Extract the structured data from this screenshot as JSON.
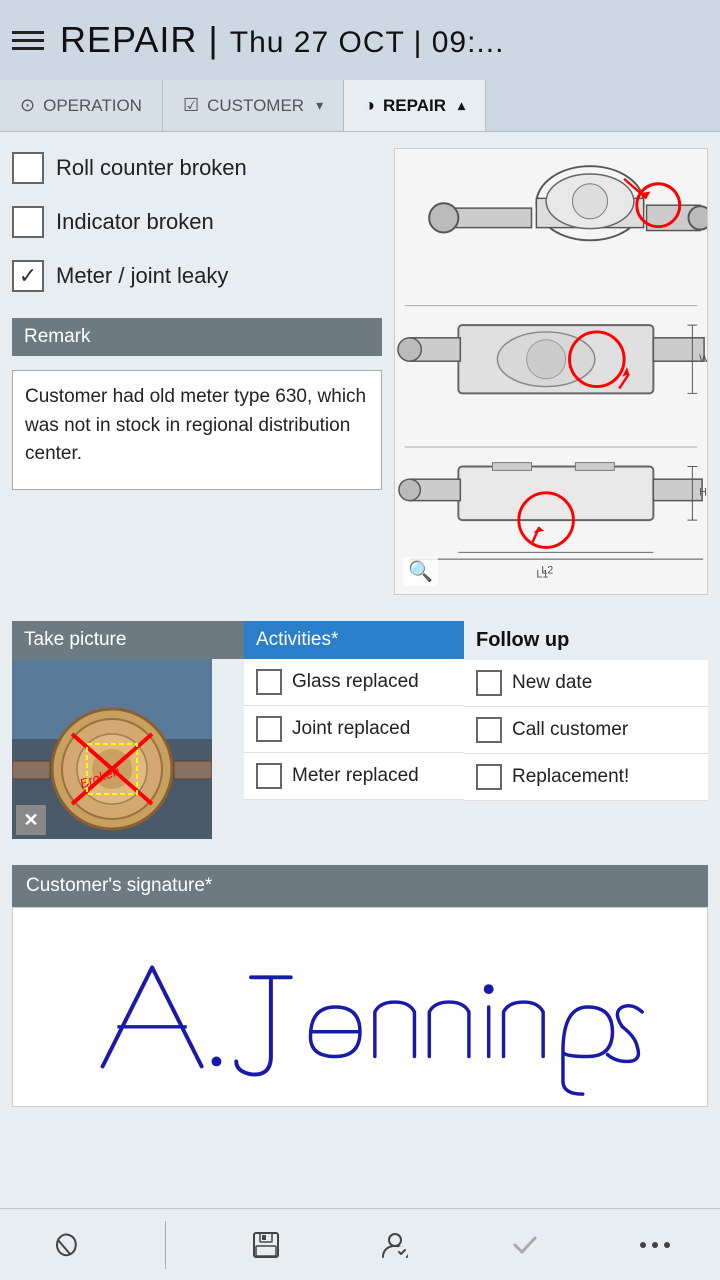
{
  "header": {
    "title": "REPAIR",
    "separator": "|",
    "datetime": "Thu 27 OCT | 09:..."
  },
  "tabs": [
    {
      "id": "operation",
      "label": "OPERATION",
      "icon": "⊙",
      "active": false,
      "hasChevron": false
    },
    {
      "id": "customer",
      "label": "CUSTOMER",
      "icon": "☑",
      "active": false,
      "hasChevron": true
    },
    {
      "id": "repair",
      "label": "REPAIR",
      "icon": "◑",
      "active": true,
      "hasChevron": true
    }
  ],
  "checkboxes": [
    {
      "id": "roll-counter",
      "label": "Roll counter broken",
      "checked": false
    },
    {
      "id": "indicator",
      "label": "Indicator broken",
      "checked": false
    },
    {
      "id": "meter-joint",
      "label": "Meter / joint leaky",
      "checked": true
    }
  ],
  "remark": {
    "header": "Remark",
    "text": "Customer had old meter type 630, which was not in stock in regional distribution center."
  },
  "sections": {
    "take_picture": {
      "header": "Take picture"
    },
    "activities": {
      "header": "Activities*",
      "items": [
        {
          "id": "glass-replaced",
          "label": "Glass replaced",
          "checked": false
        },
        {
          "id": "joint-replaced",
          "label": "Joint replaced",
          "checked": false
        },
        {
          "id": "meter-replaced",
          "label": "Meter replaced",
          "checked": false
        }
      ]
    },
    "follow_up": {
      "header": "Follow up",
      "items": [
        {
          "id": "new-date",
          "label": "New date",
          "checked": false
        },
        {
          "id": "call-customer",
          "label": "Call customer",
          "checked": false
        },
        {
          "id": "replacement",
          "label": "Replacement!",
          "checked": false
        }
      ]
    }
  },
  "signature": {
    "header": "Customer's signature*"
  },
  "toolbar": {
    "attachment_label": "📎",
    "save_label": "💾",
    "user_label": "👤",
    "check_label": "✓",
    "more_label": "•••"
  },
  "close_btn": "✕"
}
